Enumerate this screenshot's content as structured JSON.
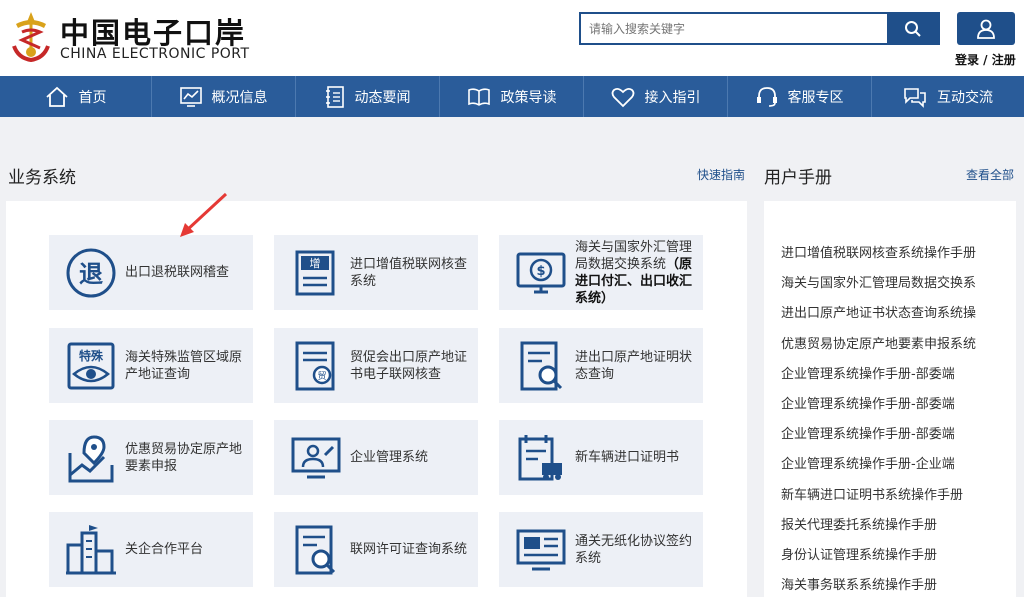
{
  "header": {
    "logo_cn": "中国电子口岸",
    "logo_en": "CHINA ELECTRONIC PORT",
    "search_placeholder": "请输入搜索关键字",
    "login_label": "登录 / 注册"
  },
  "nav": {
    "items": [
      {
        "label": "首页",
        "icon": "home-icon"
      },
      {
        "label": "概况信息",
        "icon": "chart-icon"
      },
      {
        "label": "动态要闻",
        "icon": "news-icon"
      },
      {
        "label": "政策导读",
        "icon": "book-icon"
      },
      {
        "label": "接入指引",
        "icon": "heart-icon"
      },
      {
        "label": "客服专区",
        "icon": "headset-icon"
      },
      {
        "label": "互动交流",
        "icon": "chat-icon"
      }
    ]
  },
  "business": {
    "title": "业务系统",
    "quick_link": "快速指南",
    "cards": [
      {
        "label": "出口退税联网稽查",
        "icon": "tax-refund-icon"
      },
      {
        "label": "进口增值税联网核查系统",
        "icon": "vat-document-icon"
      },
      {
        "label": "海关与国家外汇管理局数据交换系统",
        "label_bold": "（原进口付汇、出口收汇系统）",
        "icon": "forex-monitor-icon"
      },
      {
        "label": "海关特殊监管区域原产地证查询",
        "icon": "special-zone-icon"
      },
      {
        "label": "贸促会出口原产地证书电子联网核查",
        "icon": "certificate-icon"
      },
      {
        "label": "进出口原产地证明状态查询",
        "icon": "document-search-icon"
      },
      {
        "label": "优惠贸易协定原产地要素申报",
        "icon": "map-pin-icon"
      },
      {
        "label": "企业管理系统",
        "icon": "enterprise-icon"
      },
      {
        "label": "新车辆进口证明书",
        "icon": "vehicle-certificate-icon"
      },
      {
        "label": "关企合作平台",
        "icon": "building-icon"
      },
      {
        "label": "联网许可证查询系统",
        "icon": "license-search-icon"
      },
      {
        "label": "通关无纸化协议签约系统",
        "icon": "paperless-icon"
      }
    ]
  },
  "manuals": {
    "title": "用户手册",
    "view_all": "查看全部",
    "items": [
      "进口增值税联网核查系统操作手册",
      "海关与国家外汇管理局数据交换系",
      "进出口原产地证书状态查询系统操",
      "优惠贸易协定原产地要素申报系统",
      "企业管理系统操作手册-部委端",
      "企业管理系统操作手册-部委端",
      "企业管理系统操作手册-部委端",
      "企业管理系统操作手册-企业端",
      "新车辆进口证明书系统操作手册",
      "报关代理委托系统操作手册",
      "身份认证管理系统操作手册",
      "海关事务联系系统操作手册"
    ]
  },
  "colors": {
    "brand": "#1f4f8a",
    "nav": "#2a5c9a",
    "card_bg": "#edf0f6",
    "arrow": "#e53935"
  }
}
